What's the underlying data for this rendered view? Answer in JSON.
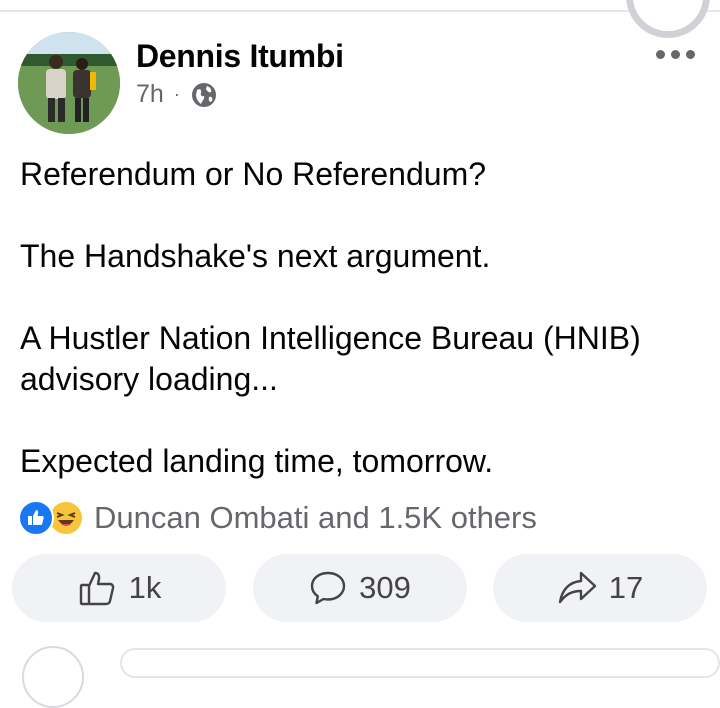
{
  "post": {
    "author": "Dennis Itumbi",
    "time": "7h",
    "separator": "·",
    "privacy_icon": "globe-icon",
    "paragraphs": [
      "Referendum or No Referendum?",
      "The Handshake's next argument.",
      "A Hustler Nation Intelligence Bureau (HNIB) advisory loading...",
      "Expected landing time, tomorrow."
    ],
    "reactions": {
      "icons": [
        "like-reaction-icon",
        "haha-reaction-icon"
      ],
      "summary": "Duncan Ombati and 1.5K others"
    },
    "actions": {
      "like_count": "1k",
      "comment_count": "309",
      "share_count": "17"
    }
  },
  "colors": {
    "like_blue": "#1877f2",
    "haha_yellow": "#f7c43a",
    "secondary_text": "#65676b",
    "button_bg": "#f0f2f5"
  }
}
